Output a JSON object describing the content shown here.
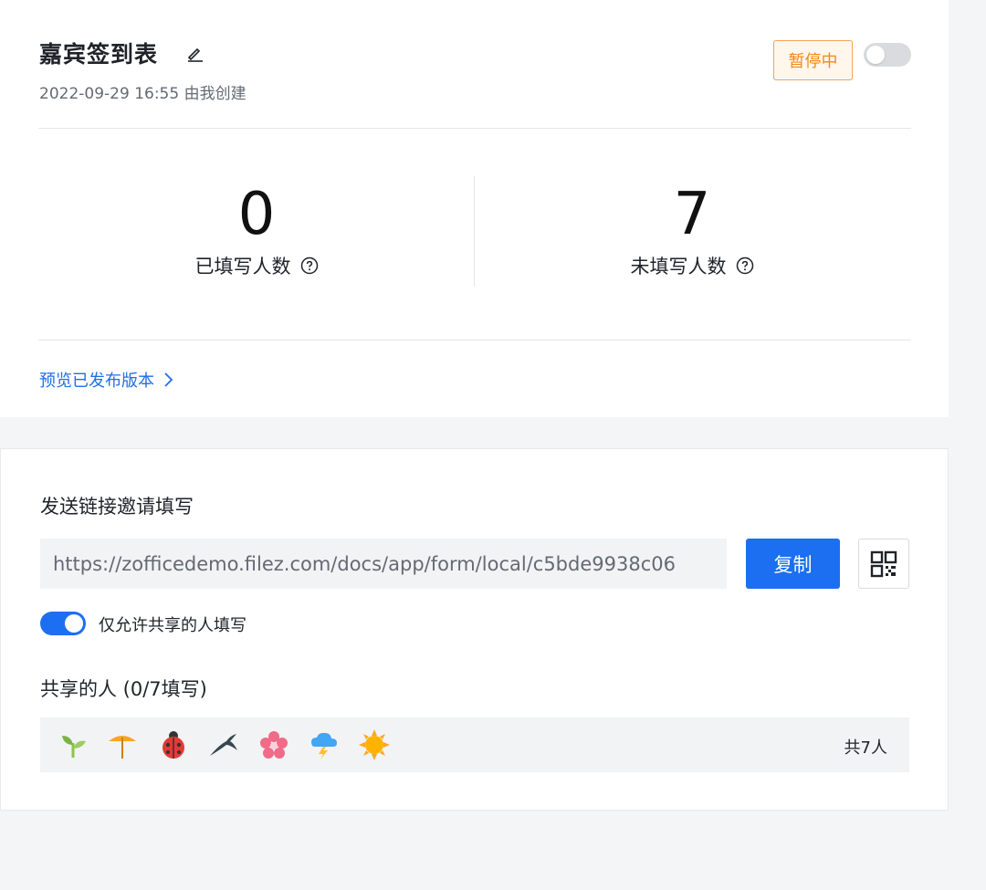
{
  "header": {
    "title": "嘉宾签到表",
    "subtitle": "2022-09-29 16:55 由我创建",
    "status": "暂停中"
  },
  "stats": {
    "filled": {
      "value": "0",
      "label": "已填写人数"
    },
    "unfilled": {
      "value": "7",
      "label": "未填写人数"
    }
  },
  "preview_link": "预览已发布版本",
  "share": {
    "section_title": "发送链接邀请填写",
    "url": "https://zofficedemo.filez.com/docs/app/form/local/c5bde9938c06",
    "copy_label": "复制",
    "restrict_toggle_label": "仅允许共享的人填写",
    "restrict_enabled": true,
    "shared_title": "共享的人 (0/7填写)",
    "total": "共7人",
    "avatars": [
      "sprout-icon",
      "parasol-icon",
      "ladybug-icon",
      "swallow-icon",
      "blossom-icon",
      "storm-cloud-icon",
      "sun-icon"
    ]
  },
  "colors": {
    "accent": "#1c6ff0",
    "status_orange": "#f08a1c",
    "link_blue": "#1f6fe5"
  }
}
